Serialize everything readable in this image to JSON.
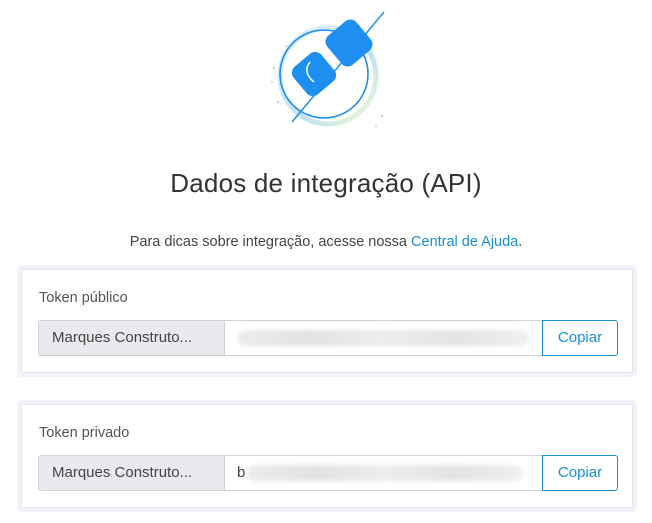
{
  "page": {
    "title": "Dados de integração (API)",
    "subtitle_prefix": "Para dicas sobre integração, acesse nossa ",
    "help_link": "Central de Ajuda",
    "subtitle_suffix": "."
  },
  "public_token": {
    "label": "Token público",
    "prefix": "Marques Construto...",
    "value": "",
    "copy_label": "Copiar"
  },
  "private_token": {
    "label": "Token privado",
    "prefix": "Marques Construto...",
    "value": "b",
    "copy_label": "Copiar"
  },
  "colors": {
    "accent": "#1a8fd8",
    "illustration_blue": "#1e8ff0",
    "card_background": "#f1f2f7"
  },
  "icons": {
    "header_illustration": "plug-connection-icon"
  }
}
